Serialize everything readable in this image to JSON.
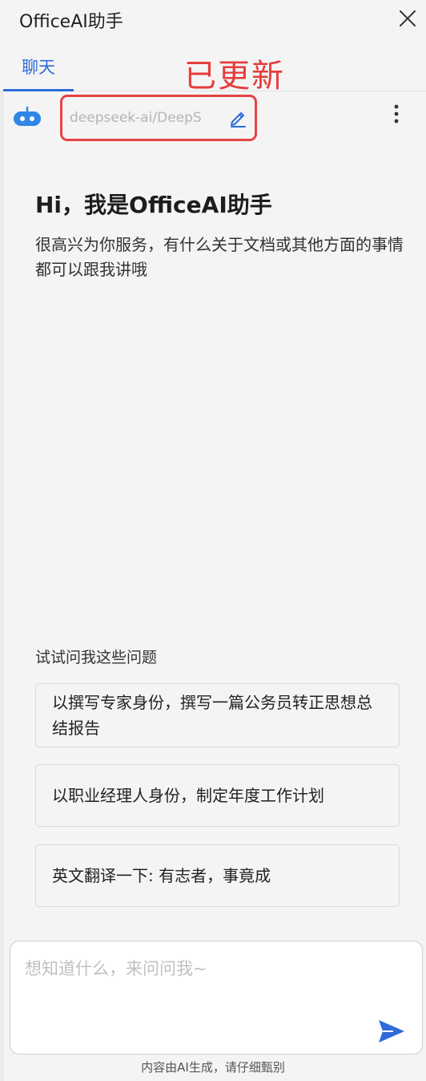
{
  "window": {
    "title": "OfficeAI助手"
  },
  "tabs": {
    "chat_label": "聊天"
  },
  "annotation": {
    "text": "已更新"
  },
  "model": {
    "value": "deepseek-ai/DeepS"
  },
  "welcome": {
    "greeting": "Hi，我是OfficeAI助手",
    "intro": "很高兴为你服务，有什么关于文档或其他方面的事情都可以跟我讲哦"
  },
  "suggestions": {
    "title": "试试问我这些问题",
    "items": [
      "以撰写专家身份，撰写一篇公务员转正思想总结报告",
      "以职业经理人身份，制定年度工作计划",
      "英文翻译一下: 有志者，事竟成"
    ]
  },
  "input": {
    "placeholder": "想知道什么，来问问我~"
  },
  "footer": {
    "note": "内容由AI生成，请仔细甄别"
  },
  "colors": {
    "accent": "#2f6bd9",
    "annotation": "#e63c3c",
    "background": "#f4f4f5"
  },
  "icons": [
    "close-icon",
    "robot-icon",
    "edit-icon",
    "more-vertical-icon",
    "send-icon"
  ]
}
